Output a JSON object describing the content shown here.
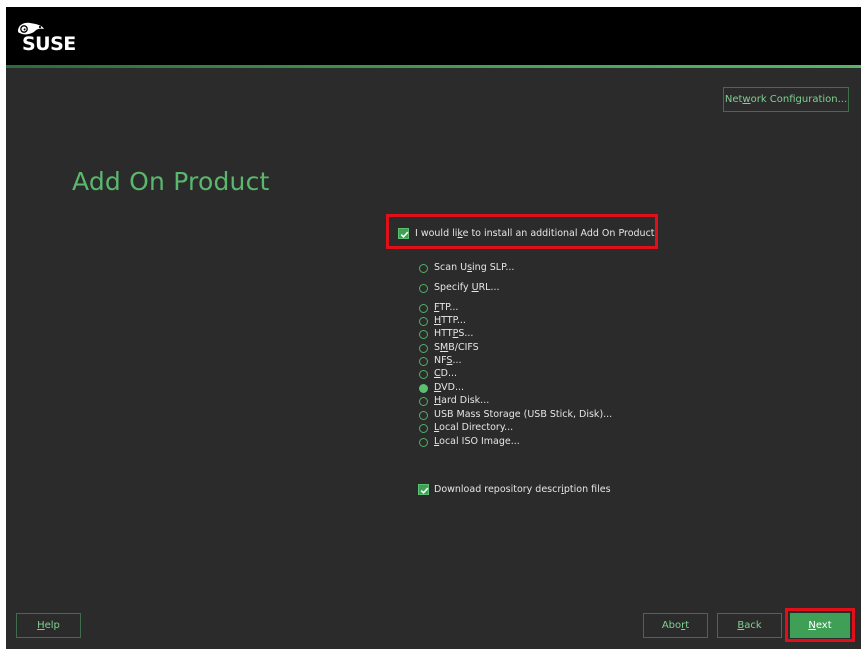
{
  "brand": {
    "logo_text": "SUSE"
  },
  "header": {
    "network_config_label_pre": "Net",
    "network_config_label_u": "w",
    "network_config_label_post": "ork Configuration..."
  },
  "page": {
    "title": "Add On Product"
  },
  "install_addon": {
    "checked": true,
    "label_pre": "I would li",
    "label_u": "k",
    "label_post": "e to install an additional Add On Product"
  },
  "sources": [
    {
      "pre": "Scan U",
      "u": "s",
      "post": "ing SLP...",
      "selected": false
    },
    {
      "pre": "Specify ",
      "u": "U",
      "post": "RL...",
      "selected": false
    },
    {
      "pre": "",
      "u": "F",
      "post": "TP...",
      "selected": false
    },
    {
      "pre": "",
      "u": "H",
      "post": "TTP...",
      "selected": false
    },
    {
      "pre": "HTT",
      "u": "P",
      "post": "S...",
      "selected": false
    },
    {
      "pre": "S",
      "u": "M",
      "post": "B/CIFS",
      "selected": false
    },
    {
      "pre": "NF",
      "u": "S",
      "post": "...",
      "selected": false
    },
    {
      "pre": "",
      "u": "C",
      "post": "D...",
      "selected": false
    },
    {
      "pre": "",
      "u": "D",
      "post": "VD...",
      "selected": true
    },
    {
      "pre": "",
      "u": "H",
      "post": "ard Disk...",
      "selected": false
    },
    {
      "pre": "USB Mass Storage (USB Stick, Disk)...",
      "u": "",
      "post": "",
      "selected": false
    },
    {
      "pre": "",
      "u": "L",
      "post": "ocal Directory...",
      "selected": false
    },
    {
      "pre": "",
      "u": "L",
      "post": "ocal ISO Image...",
      "selected": false
    }
  ],
  "download_desc": {
    "checked": true,
    "label_pre": "Download repository descr",
    "label_u": "i",
    "label_post": "ption files"
  },
  "footer": {
    "help": {
      "u": "H",
      "post": "elp"
    },
    "abort": {
      "pre": "Abo",
      "u": "r",
      "post": "t"
    },
    "back": {
      "u": "B",
      "post": "ack"
    },
    "next": {
      "u": "N",
      "post": "ext"
    }
  },
  "colors": {
    "accent": "#59b86c",
    "background": "#2b2b2b",
    "header": "#000000",
    "highlight": "#e0101a"
  }
}
